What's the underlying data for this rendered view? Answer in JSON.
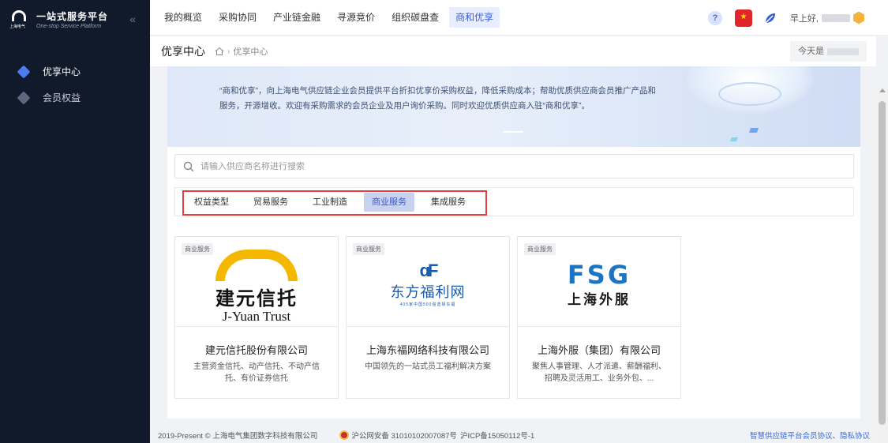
{
  "sidebar": {
    "logo_title": "一站式服务平台",
    "logo_subtitle": "One-stop Service Platform",
    "logo_mark_text": "上海电气",
    "collapse_glyph": "«",
    "items": [
      {
        "label": "优享中心",
        "active": true
      },
      {
        "label": "会员权益",
        "active": false
      }
    ]
  },
  "topnav": {
    "tabs": [
      {
        "label": "我的概览",
        "active": false
      },
      {
        "label": "采购协同",
        "active": false
      },
      {
        "label": "产业链金融",
        "active": false
      },
      {
        "label": "寻源竞价",
        "active": false
      },
      {
        "label": "组织碳盘查",
        "active": false
      },
      {
        "label": "商和优享",
        "active": true
      }
    ],
    "help_glyph": "?",
    "flag_glyph": "★",
    "greeting": "早上好,"
  },
  "breadcrumb": {
    "page_title": "优享中心",
    "separator": "›",
    "current": "优享中心",
    "date_label": "今天是"
  },
  "banner": {
    "text": "“商和优享”，向上海电气供应链企业会员提供平台折扣优享价采购权益，降低采购成本；帮助优质供应商会员推广产品和服务，开源增收。欢迎有采购需求的会员企业及用户询价采购。同时欢迎优质供应商入驻“商和优享”。"
  },
  "search": {
    "placeholder": "请输入供应商名称进行搜索"
  },
  "filters": [
    {
      "label": "权益类型",
      "active": false
    },
    {
      "label": "贸易服务",
      "active": false
    },
    {
      "label": "工业制造",
      "active": false
    },
    {
      "label": "商业服务",
      "active": true
    },
    {
      "label": "集成服务",
      "active": false
    }
  ],
  "cards": [
    {
      "tag": "商业服务",
      "logo_cn": "建元信托",
      "logo_en": "J-Yuan Trust",
      "name": "建元信托股份有限公司",
      "desc": "主营资金信托、动产信托、不动产信托、有价证券信托"
    },
    {
      "tag": "商业服务",
      "logo_mark": "ɑF",
      "logo_cn": "东方福利网",
      "logo_sub": "405家中国500强选择东福",
      "name": "上海东福网络科技有限公司",
      "desc": "中国领先的一站式员工福利解决方案"
    },
    {
      "tag": "商业服务",
      "logo_mark": "FSG",
      "logo_cn": "上海外服",
      "name": "上海外服（集团）有限公司",
      "desc": "聚焦人事管理、人才派遣、薪酬福利、招聘及灵活用工、业务外包、..."
    }
  ],
  "footer": {
    "copyright": "2019-Present © 上海电气集团数字科技有限公司",
    "police": "沪公网安备 31010102007087号",
    "icp": "沪ICP备15050112号-1",
    "link1": "智慧供应链平台会员协议",
    "link_sep": "、",
    "link2": "隐私协议"
  },
  "colors": {
    "sidebar_bg": "#111a2b",
    "accent": "#3a5fd6",
    "highlight_border": "#e24040"
  }
}
